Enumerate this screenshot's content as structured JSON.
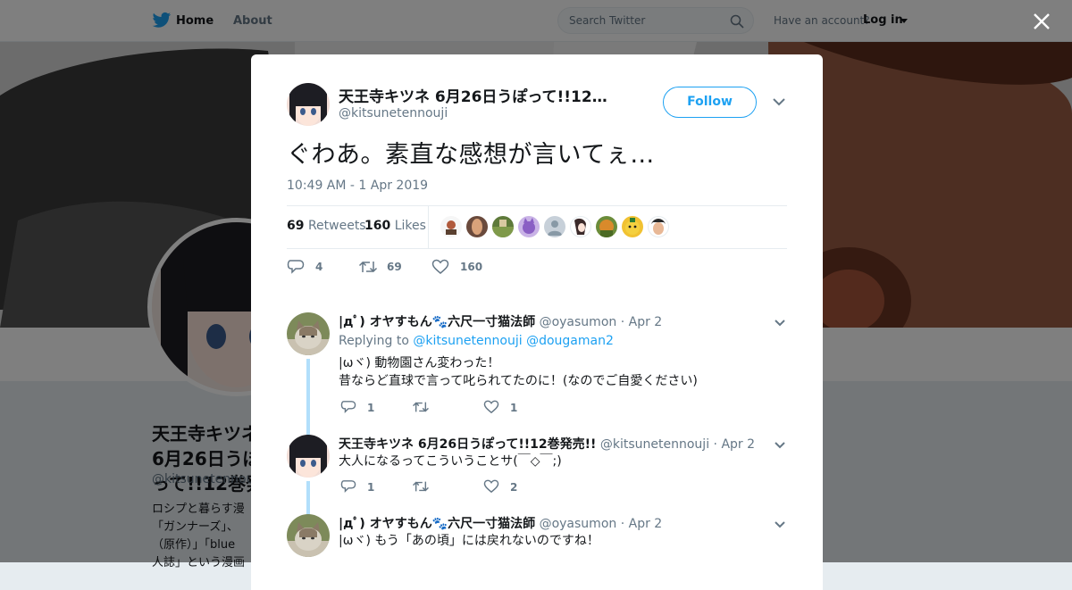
{
  "nav": {
    "home": "Home",
    "about": "About",
    "search_placeholder": "Search Twitter",
    "account_question": "Have an account?",
    "login": "Log in"
  },
  "profile": {
    "name": "天王寺キツネ 6月26日うぽって!!12巻発売!!",
    "name_visible": "天王寺キツネ 6月26日うぽって!!12巻発",
    "handle": "@kitsunetennouji",
    "bio": "ロシプと暮らす漫\n「ガンナーズ」、\n（原作）」「blue\n人誌」という漫画"
  },
  "tweet": {
    "author_name": "天王寺キツネ 6月26日うぽって!!12…",
    "author_handle": "@kitsunetennouji",
    "follow_label": "Follow",
    "text": "ぐわあ。素直な感想が言いてぇ…",
    "timestamp": "10:49 AM - 1 Apr 2019",
    "retweets_count": "69",
    "retweets_label": "Retweets",
    "likes_count": "160",
    "likes_label": "Likes",
    "reply_count": "4",
    "retweet_action_count": "69",
    "like_action_count": "160"
  },
  "replies": [
    {
      "name": "|дﾟ) オヤすもん🐾六尺一寸猫法師",
      "handle": "@oyasumon",
      "date": "· Apr 2",
      "replying_label": "Replying to",
      "replying_to_1": "@kitsunetennouji",
      "replying_to_2": "@dougaman2",
      "body": "|ωヾ) 動物園さん変わった！\n昔ならど直球で言って叱られてたのに！(なのでご自愛ください)",
      "reply_count": "1",
      "retweet_count": "",
      "like_count": "1"
    },
    {
      "name": "天王寺キツネ 6月26日うぽって!!12巻発売!!",
      "handle": "@kitsunetennouji",
      "date": "· Apr 2",
      "body": "大人になるってこういうことサ(￣◇￣;)",
      "reply_count": "1",
      "retweet_count": "",
      "like_count": "2"
    },
    {
      "name": "|дﾟ) オヤすもん🐾六尺一寸猫法師",
      "handle": "@oyasumon",
      "date": "· Apr 2",
      "body": "|ωヾ) もう「あの頃」には戻れないのですね！"
    }
  ],
  "colors": {
    "accent": "#1da1f2",
    "text": "#14171a",
    "muted": "#657786",
    "thread": "#b2dffb"
  }
}
